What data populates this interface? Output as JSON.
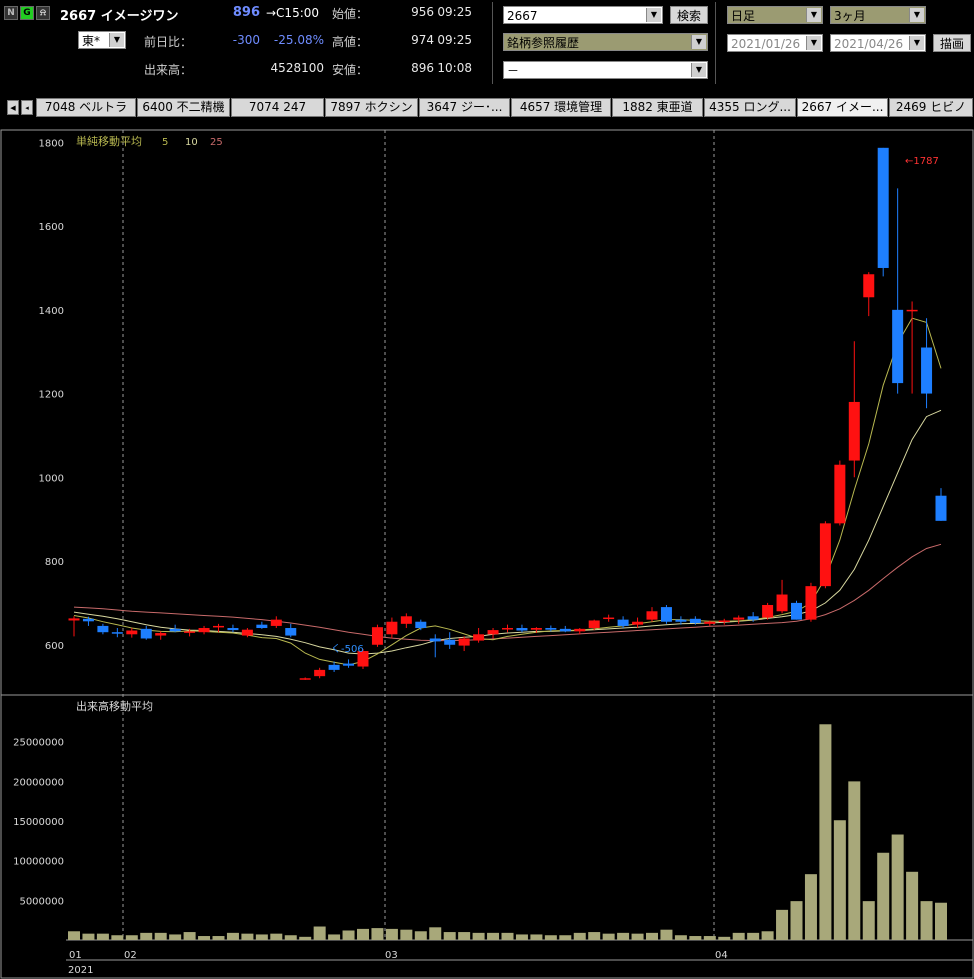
{
  "header": {
    "icons": [
      {
        "name": "n-icon",
        "glyph": "N",
        "color": "#bbbbbb",
        "bg": "#333333"
      },
      {
        "name": "g-icon",
        "glyph": "G",
        "color": "#000000",
        "bg": "#22cc22"
      },
      {
        "name": "bell-icon",
        "glyph": "⍾",
        "color": "#dddddd",
        "bg": "#333333"
      }
    ],
    "code_name": "2667 イメージワン",
    "price": "896",
    "price_time": "→C15:00",
    "market": "東*",
    "change_label": "前日比：",
    "change": "-300",
    "change_pct": "-25.08%",
    "volume_label": "出来高：",
    "volume": "4528100",
    "open_label": "始値：",
    "open_value": "956",
    "open_time": "09:25",
    "high_label": "高値：",
    "high_value": "974",
    "high_time": "09:25",
    "low_label": "安値：",
    "low_value": "896",
    "low_time": "10:08"
  },
  "controls": {
    "code_input": "2667",
    "search_label": "検索",
    "history_select": "銘柄参照履歴",
    "extra_select": "－",
    "period_select": "日足",
    "range_select": "3ヶ月",
    "date_from": "2021/01/26",
    "date_to": "2021/04/26",
    "draw_label": "描画"
  },
  "tabs": [
    {
      "label": "7048 ベルトラ"
    },
    {
      "label": "6400 不二精機"
    },
    {
      "label": "7074 247"
    },
    {
      "label": "7897 ホクシン"
    },
    {
      "label": "3647 ジー･..."
    },
    {
      "label": "4657 環境管理"
    },
    {
      "label": "1882 東亜道"
    },
    {
      "label": "4355 ロング..."
    },
    {
      "label": "2667 イメー..."
    },
    {
      "label": "2469 ヒビノ"
    }
  ],
  "colors": {
    "up": "#ff1111",
    "down": "#1e7fff",
    "ma5": "#b8b850",
    "ma10": "#d8d8a0",
    "ma25": "#c86a6a",
    "volume": "#a8a87a",
    "grid": "#9a9a9a"
  },
  "chart": {
    "ma_title": "単純移動平均",
    "ma_periods": [
      "5",
      "10",
      "25"
    ],
    "vol_title": "出来高移動平均",
    "high_annotation": "←1787",
    "low_annotation": "く-506",
    "x_labels": [
      "01",
      "02",
      "03",
      "04"
    ],
    "year_label": "2021"
  },
  "chart_data": {
    "type": "candlestick",
    "price_ylim": [
      480,
      1820
    ],
    "price_ticks": [
      600,
      800,
      1000,
      1200,
      1400,
      1600,
      1800
    ],
    "volume_ylim": [
      0,
      29000000
    ],
    "volume_ticks": [
      5000000,
      10000000,
      15000000,
      20000000,
      25000000
    ],
    "candles": [
      {
        "o": 658,
        "h": 668,
        "l": 620,
        "c": 663
      },
      {
        "o": 662,
        "h": 667,
        "l": 645,
        "c": 656
      },
      {
        "o": 645,
        "h": 650,
        "l": 625,
        "c": 630
      },
      {
        "o": 630,
        "h": 640,
        "l": 618,
        "c": 628
      },
      {
        "o": 625,
        "h": 640,
        "l": 617,
        "c": 634
      },
      {
        "o": 638,
        "h": 645,
        "l": 612,
        "c": 615
      },
      {
        "o": 622,
        "h": 632,
        "l": 612,
        "c": 628
      },
      {
        "o": 638,
        "h": 648,
        "l": 630,
        "c": 632
      },
      {
        "o": 630,
        "h": 638,
        "l": 620,
        "c": 632
      },
      {
        "o": 630,
        "h": 645,
        "l": 625,
        "c": 640
      },
      {
        "o": 643,
        "h": 650,
        "l": 630,
        "c": 645
      },
      {
        "o": 640,
        "h": 648,
        "l": 630,
        "c": 635
      },
      {
        "o": 622,
        "h": 640,
        "l": 618,
        "c": 636
      },
      {
        "o": 648,
        "h": 655,
        "l": 638,
        "c": 640
      },
      {
        "o": 645,
        "h": 668,
        "l": 640,
        "c": 660
      },
      {
        "o": 640,
        "h": 650,
        "l": 618,
        "c": 622
      },
      {
        "o": 518,
        "h": 522,
        "l": 516,
        "c": 520
      },
      {
        "o": 525,
        "h": 545,
        "l": 520,
        "c": 540
      },
      {
        "o": 552,
        "h": 560,
        "l": 535,
        "c": 540
      },
      {
        "o": 555,
        "h": 565,
        "l": 545,
        "c": 550
      },
      {
        "o": 548,
        "h": 590,
        "l": 542,
        "c": 585
      },
      {
        "o": 600,
        "h": 648,
        "l": 595,
        "c": 642
      },
      {
        "o": 625,
        "h": 665,
        "l": 615,
        "c": 655
      },
      {
        "o": 650,
        "h": 675,
        "l": 640,
        "c": 668
      },
      {
        "o": 655,
        "h": 660,
        "l": 635,
        "c": 640
      },
      {
        "o": 615,
        "h": 625,
        "l": 570,
        "c": 608
      },
      {
        "o": 612,
        "h": 630,
        "l": 590,
        "c": 600
      },
      {
        "o": 598,
        "h": 620,
        "l": 585,
        "c": 615
      },
      {
        "o": 610,
        "h": 640,
        "l": 605,
        "c": 625
      },
      {
        "o": 625,
        "h": 640,
        "l": 615,
        "c": 635
      },
      {
        "o": 638,
        "h": 648,
        "l": 630,
        "c": 640
      },
      {
        "o": 640,
        "h": 648,
        "l": 630,
        "c": 634
      },
      {
        "o": 636,
        "h": 642,
        "l": 628,
        "c": 640
      },
      {
        "o": 640,
        "h": 646,
        "l": 632,
        "c": 636
      },
      {
        "o": 638,
        "h": 645,
        "l": 630,
        "c": 632
      },
      {
        "o": 632,
        "h": 640,
        "l": 625,
        "c": 638
      },
      {
        "o": 640,
        "h": 660,
        "l": 635,
        "c": 658
      },
      {
        "o": 662,
        "h": 672,
        "l": 655,
        "c": 665
      },
      {
        "o": 660,
        "h": 668,
        "l": 640,
        "c": 645
      },
      {
        "o": 648,
        "h": 665,
        "l": 640,
        "c": 655
      },
      {
        "o": 660,
        "h": 690,
        "l": 655,
        "c": 680
      },
      {
        "o": 690,
        "h": 695,
        "l": 650,
        "c": 655
      },
      {
        "o": 660,
        "h": 668,
        "l": 648,
        "c": 655
      },
      {
        "o": 662,
        "h": 668,
        "l": 648,
        "c": 652
      },
      {
        "o": 650,
        "h": 658,
        "l": 645,
        "c": 655
      },
      {
        "o": 655,
        "h": 662,
        "l": 648,
        "c": 658
      },
      {
        "o": 660,
        "h": 670,
        "l": 650,
        "c": 665
      },
      {
        "o": 668,
        "h": 678,
        "l": 655,
        "c": 660
      },
      {
        "o": 665,
        "h": 700,
        "l": 660,
        "c": 695
      },
      {
        "o": 680,
        "h": 755,
        "l": 675,
        "c": 720
      },
      {
        "o": 700,
        "h": 705,
        "l": 660,
        "c": 660
      },
      {
        "o": 660,
        "h": 748,
        "l": 655,
        "c": 740
      },
      {
        "o": 740,
        "h": 895,
        "l": 735,
        "c": 890
      },
      {
        "o": 890,
        "h": 1040,
        "l": 885,
        "c": 1030
      },
      {
        "o": 1040,
        "h": 1325,
        "l": 1000,
        "c": 1180
      },
      {
        "o": 1430,
        "h": 1490,
        "l": 1385,
        "c": 1485
      },
      {
        "o": 1787,
        "h": 1787,
        "l": 1480,
        "c": 1500
      },
      {
        "o": 1400,
        "h": 1690,
        "l": 1200,
        "c": 1225
      },
      {
        "o": 1400,
        "h": 1420,
        "l": 1200,
        "c": 1400
      },
      {
        "o": 1310,
        "h": 1380,
        "l": 1165,
        "c": 1200
      },
      {
        "o": 956,
        "h": 974,
        "l": 896,
        "c": 896
      }
    ],
    "volumes": [
      1100000,
      800000,
      800000,
      600000,
      600000,
      900000,
      900000,
      700000,
      1000000,
      500000,
      500000,
      900000,
      800000,
      700000,
      800000,
      600000,
      400000,
      1700000,
      700000,
      1200000,
      1400000,
      1500000,
      1400000,
      1300000,
      1100000,
      1600000,
      1000000,
      1000000,
      900000,
      900000,
      900000,
      700000,
      700000,
      600000,
      600000,
      900000,
      1000000,
      800000,
      900000,
      800000,
      900000,
      1300000,
      600000,
      500000,
      500000,
      400000,
      900000,
      900000,
      1100000,
      3800000,
      4900000,
      8300000,
      27200000,
      15100000,
      20000000,
      4900000,
      11000000,
      13300000,
      8600000,
      4900000,
      4700000
    ],
    "ma5": [
      670,
      664,
      655,
      648,
      640,
      635,
      632,
      631,
      633,
      632,
      630,
      628,
      623,
      617,
      615,
      604,
      580,
      565,
      558,
      552,
      560,
      578,
      600,
      622,
      640,
      645,
      637,
      626,
      615,
      612,
      620,
      625,
      630,
      633,
      634,
      635,
      638,
      642,
      645,
      650,
      655,
      660,
      660,
      658,
      656,
      656,
      657,
      660,
      665,
      672,
      680,
      700,
      760,
      850,
      970,
      1080,
      1220,
      1320,
      1380,
      1370,
      1260
    ],
    "ma10": [
      678,
      673,
      668,
      662,
      655,
      648,
      642,
      638,
      635,
      634,
      632,
      630,
      627,
      624,
      620,
      613,
      605,
      595,
      588,
      580,
      578,
      580,
      585,
      593,
      600,
      610,
      615,
      618,
      620,
      625,
      628,
      630,
      632,
      632,
      633,
      634,
      636,
      638,
      640,
      642,
      645,
      648,
      650,
      651,
      652,
      654,
      656,
      659,
      663,
      667,
      672,
      681,
      700,
      730,
      780,
      850,
      930,
      1010,
      1090,
      1145,
      1160
    ],
    "ma25": [
      690,
      688,
      686,
      683,
      680,
      678,
      676,
      674,
      672,
      670,
      668,
      666,
      663,
      660,
      656,
      652,
      647,
      642,
      636,
      630,
      625,
      620,
      616,
      613,
      611,
      610,
      610,
      611,
      612,
      614,
      616,
      618,
      620,
      622,
      624,
      626,
      628,
      630,
      632,
      634,
      636,
      638,
      640,
      642,
      644,
      645,
      647,
      649,
      651,
      653,
      656,
      662,
      672,
      686,
      706,
      730,
      758,
      785,
      810,
      830,
      840
    ]
  }
}
